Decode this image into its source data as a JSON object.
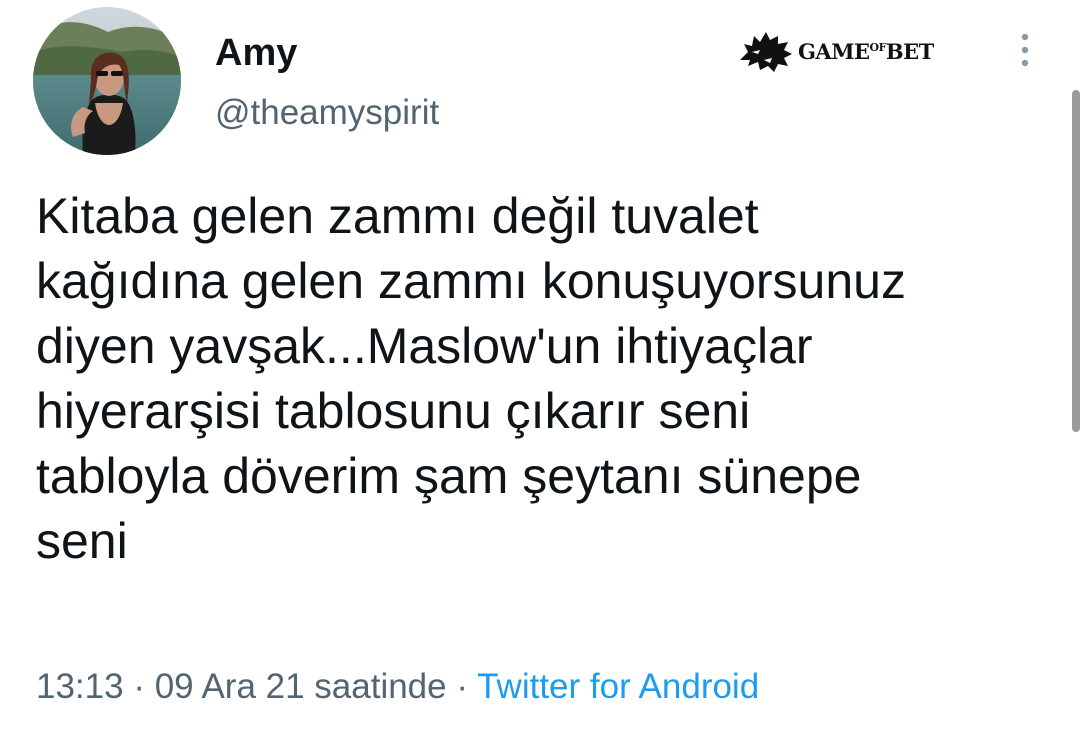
{
  "tweet": {
    "author": {
      "display_name": "Amy",
      "handle": "@theamyspirit",
      "avatar_icon": "profile-photo"
    },
    "text_lines": [
      "Kitaba gelen zammı değil tuvalet",
      "kağıdına gelen zammı konuşuyorsunuz",
      "diyen yavşak...Maslow'un ihtiyaçlar",
      "hiyerarşisi tablosunu çıkarır seni",
      "tabloyla döverim şam şeytanı sünepe",
      "seni"
    ],
    "time": "13:13",
    "date": "09 Ara 21 saatinde",
    "separator": "·",
    "source": "Twitter for Android",
    "more_icon": "vertical-ellipsis-icon"
  },
  "watermark": {
    "text_main_1": "GAME",
    "text_small": "OF",
    "text_main_2": "BET",
    "icon": "wolf-head-icon"
  },
  "colors": {
    "text_primary": "#0f1419",
    "text_secondary": "#536471",
    "link": "#1d9bf0",
    "background": "#ffffff"
  }
}
